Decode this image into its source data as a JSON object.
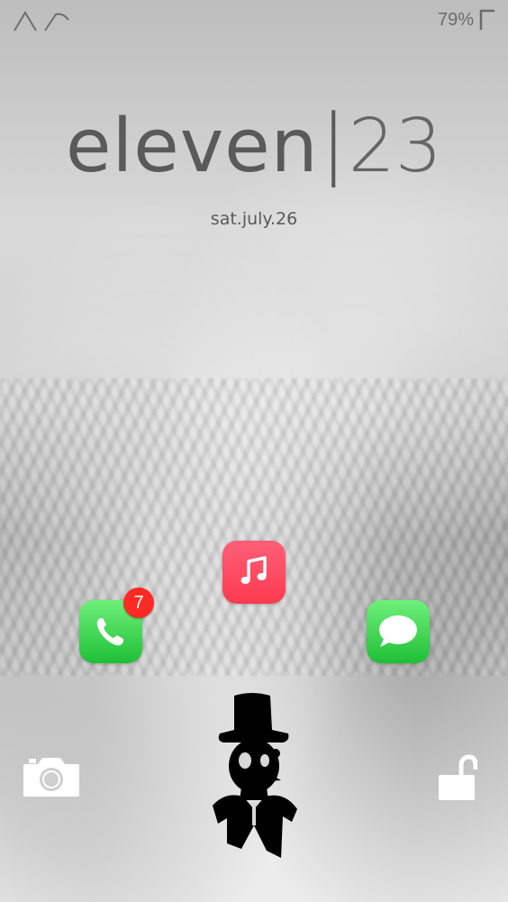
{
  "status_bar": {
    "left_icon": "signal-glyph-icon",
    "battery_percent": "79%",
    "battery_icon": "battery-corner-icon"
  },
  "lockscreen": {
    "clock": {
      "hour_text": "eleven",
      "separator": "|",
      "minute_text": "23"
    },
    "date": "sat.july.26"
  },
  "apps": [
    {
      "name": "Music",
      "icon": "music-note-icon",
      "color": "#fd3a4e"
    },
    {
      "name": "Phone",
      "icon": "phone-handset-icon",
      "color": "#26c23a",
      "badge": "7"
    },
    {
      "name": "Messages",
      "icon": "speech-bubble-icon",
      "color": "#26c23a"
    }
  ],
  "actions": {
    "camera_icon": "camera-icon",
    "unlock_icon": "open-padlock-icon"
  },
  "decor": {
    "mascot_icon": "top-hat-gentleman-icon"
  }
}
